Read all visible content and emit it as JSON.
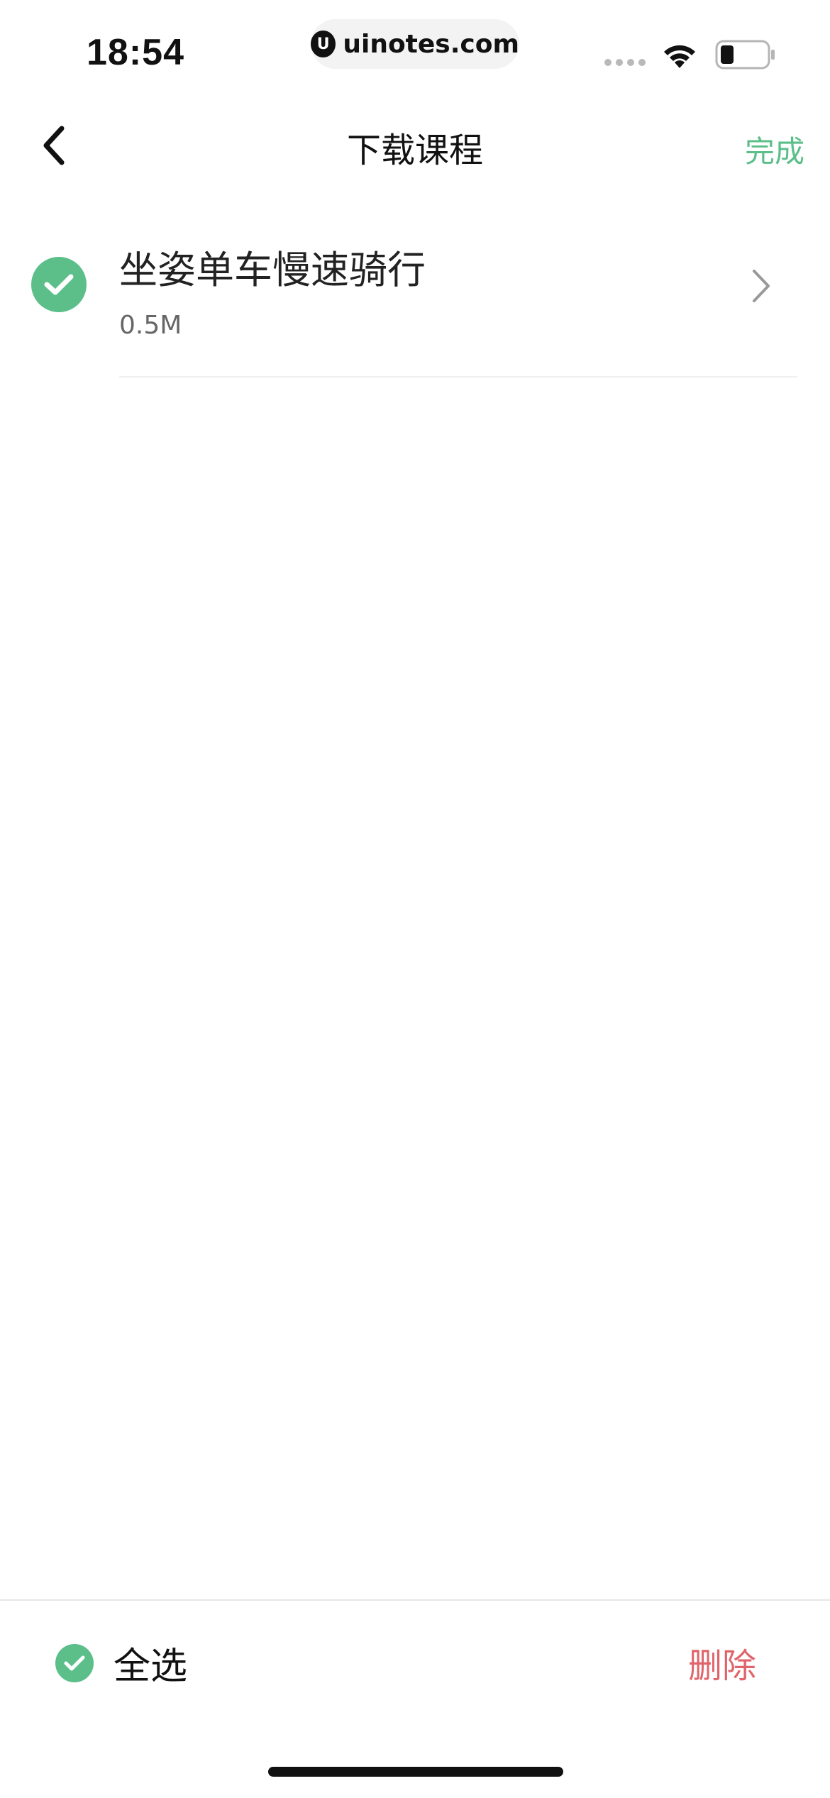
{
  "status_bar": {
    "time": "18:54",
    "watermark_logo": "U",
    "watermark_text": "uinotes.com",
    "icons": [
      "signal-dots-icon",
      "wifi-icon",
      "battery-icon"
    ]
  },
  "nav": {
    "back_icon": "chevron-left-icon",
    "title": "下载课程",
    "done_label": "完成"
  },
  "courses": [
    {
      "title": "坐姿单车慢速骑行",
      "size": "0.5M",
      "selected": true,
      "chevron_icon": "chevron-right-icon"
    }
  ],
  "bottom_bar": {
    "select_all_label": "全选",
    "select_all_selected": true,
    "delete_label": "删除"
  },
  "colors": {
    "accent_green": "#5cbf8a",
    "delete_red": "#e0656b",
    "text_primary": "#222222",
    "text_secondary": "#666666"
  }
}
